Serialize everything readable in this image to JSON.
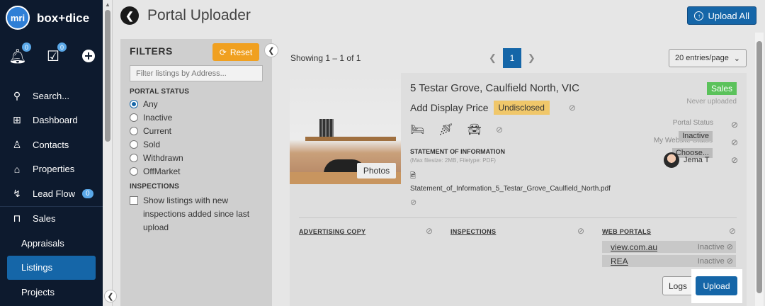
{
  "sidebar": {
    "logo_text": "mri",
    "brand": "box+dice",
    "notif_badge": "0",
    "tasks_badge": "0",
    "items": [
      {
        "label": "Search..."
      },
      {
        "label": "Dashboard"
      },
      {
        "label": "Contacts"
      },
      {
        "label": "Properties"
      },
      {
        "label": "Lead Flow",
        "badge": "0"
      },
      {
        "label": "Sales"
      },
      {
        "label": "Appraisals"
      },
      {
        "label": "Listings"
      },
      {
        "label": "Projects"
      }
    ]
  },
  "header": {
    "title": "Portal Uploader",
    "upload_all": "Upload All"
  },
  "filters": {
    "title": "FILTERS",
    "reset": "Reset",
    "search_placeholder": "Filter listings by Address...",
    "portal_status_title": "PORTAL STATUS",
    "statuses": [
      "Any",
      "Inactive",
      "Current",
      "Sold",
      "Withdrawn",
      "OffMarket"
    ],
    "selected_status": "Any",
    "inspections_title": "INSPECTIONS",
    "inspections_checkbox": "Show listings with new inspections added since last upload"
  },
  "results": {
    "showing": "Showing 1 – 1 of 1",
    "page": "1",
    "entries": "20 entries/page"
  },
  "listing": {
    "photos_label": "Photos",
    "address": "5 Testar Grove, Caulfield North, VIC",
    "display_price_label": "Add Display Price",
    "display_price_value": "Undisclosed",
    "type_badge": "Sales",
    "upload_state": "Never uploaded",
    "soi_title": "STATEMENT OF INFORMATION",
    "soi_hint": "(Max filesize: 2MB, Filetype: PDF)",
    "soi_file": "Statement_of_Information_5_Testar_Grove_Caulfield_North.pdf",
    "portal_status_label": "Portal Status",
    "portal_status_value": "Inactive",
    "my_website_status_label": "My Website Status",
    "choose_label": "Choose...",
    "agent_name": "Jema T",
    "sections": {
      "advertising_copy": "ADVERTISING COPY",
      "inspections": "INSPECTIONS",
      "web_portals": "WEB PORTALS"
    },
    "portals": [
      {
        "name": "view.com.au",
        "status": "Inactive"
      },
      {
        "name": "REA",
        "status": "Inactive"
      }
    ],
    "logs_button": "Logs",
    "upload_button": "Upload"
  },
  "colors": {
    "sidebar_bg": "#0d1a2e",
    "accent_blue": "#1566a8",
    "reset_orange": "#f0a020",
    "sales_green": "#5bc25b",
    "undisclosed_yellow": "#f0c76a"
  }
}
